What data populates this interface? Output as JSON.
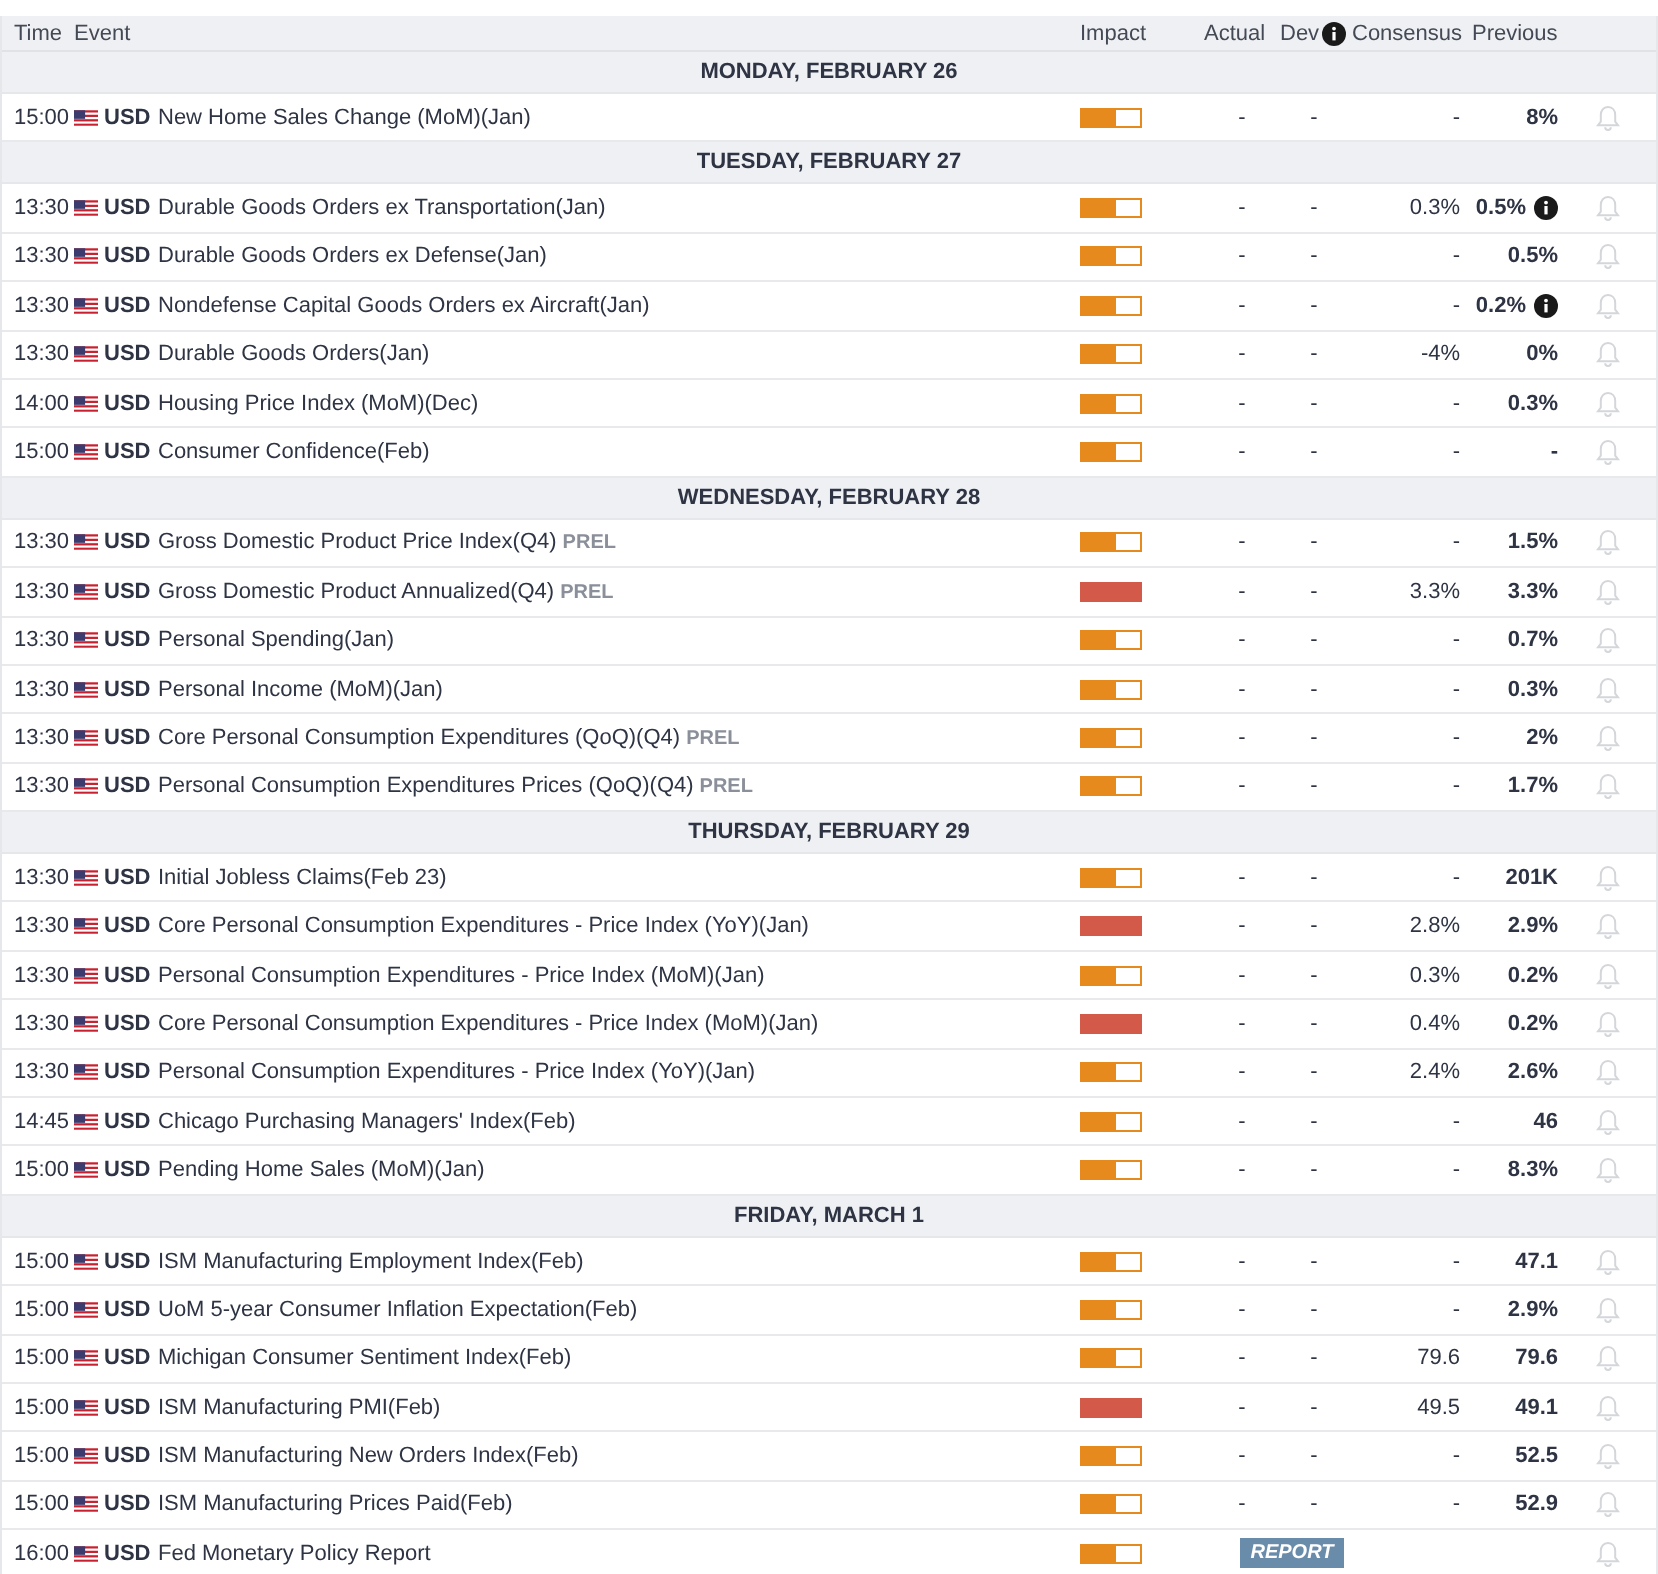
{
  "columns": {
    "time": "Time",
    "event": "Event",
    "impact": "Impact",
    "actual": "Actual",
    "dev": "Dev",
    "consensus": "Consensus",
    "previous": "Previous"
  },
  "days": [
    {
      "label": "MONDAY, FEBRUARY 26",
      "events": [
        {
          "time": "15:00",
          "currency": "USD",
          "name": "New Home Sales Change (MoM)(Jan)",
          "impact": {
            "level": 0.6,
            "color": "#e68a1e"
          },
          "actual": "-",
          "dev": "-",
          "consensus": "-",
          "previous": "8%",
          "info": false
        }
      ]
    },
    {
      "label": "TUESDAY, FEBRUARY 27",
      "events": [
        {
          "time": "13:30",
          "currency": "USD",
          "name": "Durable Goods Orders ex Transportation(Jan)",
          "impact": {
            "level": 0.6,
            "color": "#e68a1e"
          },
          "actual": "-",
          "dev": "-",
          "consensus": "0.3%",
          "previous": "0.5%",
          "info": true
        },
        {
          "time": "13:30",
          "currency": "USD",
          "name": "Durable Goods Orders ex Defense(Jan)",
          "impact": {
            "level": 0.6,
            "color": "#e68a1e"
          },
          "actual": "-",
          "dev": "-",
          "consensus": "-",
          "previous": "0.5%",
          "info": false
        },
        {
          "time": "13:30",
          "currency": "USD",
          "name": "Nondefense Capital Goods Orders ex Aircraft(Jan)",
          "impact": {
            "level": 0.6,
            "color": "#e68a1e"
          },
          "actual": "-",
          "dev": "-",
          "consensus": "-",
          "previous": "0.2%",
          "info": true
        },
        {
          "time": "13:30",
          "currency": "USD",
          "name": "Durable Goods Orders(Jan)",
          "impact": {
            "level": 0.6,
            "color": "#e68a1e"
          },
          "actual": "-",
          "dev": "-",
          "consensus": "-4%",
          "previous": "0%",
          "info": false
        },
        {
          "time": "14:00",
          "currency": "USD",
          "name": "Housing Price Index (MoM)(Dec)",
          "impact": {
            "level": 0.6,
            "color": "#e68a1e"
          },
          "actual": "-",
          "dev": "-",
          "consensus": "-",
          "previous": "0.3%",
          "info": false
        },
        {
          "time": "15:00",
          "currency": "USD",
          "name": "Consumer Confidence(Feb)",
          "impact": {
            "level": 0.6,
            "color": "#e68a1e"
          },
          "actual": "-",
          "dev": "-",
          "consensus": "-",
          "previous": "-",
          "info": false
        }
      ]
    },
    {
      "label": "WEDNESDAY, FEBRUARY 28",
      "events": [
        {
          "time": "13:30",
          "currency": "USD",
          "name": "Gross Domestic Product Price Index(Q4)",
          "tag": "PREL",
          "impact": {
            "level": 0.6,
            "color": "#e68a1e"
          },
          "actual": "-",
          "dev": "-",
          "consensus": "-",
          "previous": "1.5%",
          "info": false
        },
        {
          "time": "13:30",
          "currency": "USD",
          "name": "Gross Domestic Product Annualized(Q4)",
          "tag": "PREL",
          "impact": {
            "level": 1,
            "color": "#d35a48"
          },
          "actual": "-",
          "dev": "-",
          "consensus": "3.3%",
          "previous": "3.3%",
          "info": false
        },
        {
          "time": "13:30",
          "currency": "USD",
          "name": "Personal Spending(Jan)",
          "impact": {
            "level": 0.6,
            "color": "#e68a1e"
          },
          "actual": "-",
          "dev": "-",
          "consensus": "-",
          "previous": "0.7%",
          "info": false
        },
        {
          "time": "13:30",
          "currency": "USD",
          "name": "Personal Income (MoM)(Jan)",
          "impact": {
            "level": 0.6,
            "color": "#e68a1e"
          },
          "actual": "-",
          "dev": "-",
          "consensus": "-",
          "previous": "0.3%",
          "info": false
        },
        {
          "time": "13:30",
          "currency": "USD",
          "name": "Core Personal Consumption Expenditures (QoQ)(Q4)",
          "tag": "PREL",
          "impact": {
            "level": 0.6,
            "color": "#e68a1e"
          },
          "actual": "-",
          "dev": "-",
          "consensus": "-",
          "previous": "2%",
          "info": false
        },
        {
          "time": "13:30",
          "currency": "USD",
          "name": "Personal Consumption Expenditures Prices (QoQ)(Q4)",
          "tag": "PREL",
          "impact": {
            "level": 0.6,
            "color": "#e68a1e"
          },
          "actual": "-",
          "dev": "-",
          "consensus": "-",
          "previous": "1.7%",
          "info": false
        }
      ]
    },
    {
      "label": "THURSDAY, FEBRUARY 29",
      "events": [
        {
          "time": "13:30",
          "currency": "USD",
          "name": "Initial Jobless Claims(Feb 23)",
          "impact": {
            "level": 0.6,
            "color": "#e68a1e"
          },
          "actual": "-",
          "dev": "-",
          "consensus": "-",
          "previous": "201K",
          "info": false
        },
        {
          "time": "13:30",
          "currency": "USD",
          "name": "Core Personal Consumption Expenditures - Price Index (YoY)(Jan)",
          "impact": {
            "level": 1,
            "color": "#d35a48"
          },
          "actual": "-",
          "dev": "-",
          "consensus": "2.8%",
          "previous": "2.9%",
          "info": false
        },
        {
          "time": "13:30",
          "currency": "USD",
          "name": "Personal Consumption Expenditures - Price Index (MoM)(Jan)",
          "impact": {
            "level": 0.6,
            "color": "#e68a1e"
          },
          "actual": "-",
          "dev": "-",
          "consensus": "0.3%",
          "previous": "0.2%",
          "info": false
        },
        {
          "time": "13:30",
          "currency": "USD",
          "name": "Core Personal Consumption Expenditures - Price Index (MoM)(Jan)",
          "impact": {
            "level": 1,
            "color": "#d35a48"
          },
          "actual": "-",
          "dev": "-",
          "consensus": "0.4%",
          "previous": "0.2%",
          "info": false
        },
        {
          "time": "13:30",
          "currency": "USD",
          "name": "Personal Consumption Expenditures - Price Index (YoY)(Jan)",
          "impact": {
            "level": 0.6,
            "color": "#e68a1e"
          },
          "actual": "-",
          "dev": "-",
          "consensus": "2.4%",
          "previous": "2.6%",
          "info": false
        },
        {
          "time": "14:45",
          "currency": "USD",
          "name": "Chicago Purchasing Managers' Index(Feb)",
          "impact": {
            "level": 0.6,
            "color": "#e68a1e"
          },
          "actual": "-",
          "dev": "-",
          "consensus": "-",
          "previous": "46",
          "info": false
        },
        {
          "time": "15:00",
          "currency": "USD",
          "name": "Pending Home Sales (MoM)(Jan)",
          "impact": {
            "level": 0.6,
            "color": "#e68a1e"
          },
          "actual": "-",
          "dev": "-",
          "consensus": "-",
          "previous": "8.3%",
          "info": false
        }
      ]
    },
    {
      "label": "FRIDAY, MARCH 1",
      "events": [
        {
          "time": "15:00",
          "currency": "USD",
          "name": "ISM Manufacturing Employment Index(Feb)",
          "impact": {
            "level": 0.6,
            "color": "#e68a1e"
          },
          "actual": "-",
          "dev": "-",
          "consensus": "-",
          "previous": "47.1",
          "info": false
        },
        {
          "time": "15:00",
          "currency": "USD",
          "name": "UoM 5-year Consumer Inflation Expectation(Feb)",
          "impact": {
            "level": 0.6,
            "color": "#e68a1e"
          },
          "actual": "-",
          "dev": "-",
          "consensus": "-",
          "previous": "2.9%",
          "info": false
        },
        {
          "time": "15:00",
          "currency": "USD",
          "name": "Michigan Consumer Sentiment Index(Feb)",
          "impact": {
            "level": 0.6,
            "color": "#e68a1e"
          },
          "actual": "-",
          "dev": "-",
          "consensus": "79.6",
          "previous": "79.6",
          "info": false
        },
        {
          "time": "15:00",
          "currency": "USD",
          "name": "ISM Manufacturing PMI(Feb)",
          "impact": {
            "level": 1,
            "color": "#d35a48"
          },
          "actual": "-",
          "dev": "-",
          "consensus": "49.5",
          "previous": "49.1",
          "info": false
        },
        {
          "time": "15:00",
          "currency": "USD",
          "name": "ISM Manufacturing New Orders Index(Feb)",
          "impact": {
            "level": 0.6,
            "color": "#e68a1e"
          },
          "actual": "-",
          "dev": "-",
          "consensus": "-",
          "previous": "52.5",
          "info": false
        },
        {
          "time": "15:00",
          "currency": "USD",
          "name": "ISM Manufacturing Prices Paid(Feb)",
          "impact": {
            "level": 0.6,
            "color": "#e68a1e"
          },
          "actual": "-",
          "dev": "-",
          "consensus": "-",
          "previous": "52.9",
          "info": false
        },
        {
          "time": "16:00",
          "currency": "USD",
          "name": "Fed Monetary Policy Report",
          "impact": {
            "level": 0.6,
            "color": "#e68a1e"
          },
          "report": "REPORT",
          "info": false
        }
      ]
    }
  ]
}
